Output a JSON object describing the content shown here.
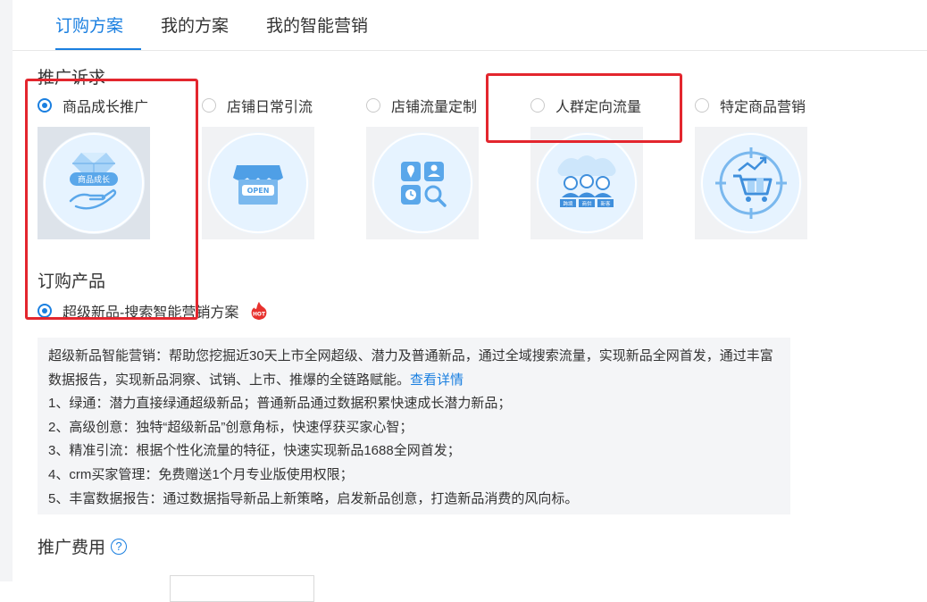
{
  "tabs": [
    {
      "label": "订购方案",
      "active": true
    },
    {
      "label": "我的方案",
      "active": false
    },
    {
      "label": "我的智能营销",
      "active": false
    }
  ],
  "promotion": {
    "title": "推广诉求",
    "options": [
      {
        "label": "商品成长推广",
        "checked": true,
        "icon": "diamond-growth-icon",
        "badge_text": "商品成长"
      },
      {
        "label": "店铺日常引流",
        "checked": false,
        "icon": "open-store-icon",
        "badge_text": "OPEN"
      },
      {
        "label": "店铺流量定制",
        "checked": false,
        "icon": "location-user-clock-search-icon"
      },
      {
        "label": "人群定向流量",
        "checked": false,
        "icon": "crowd-people-icon",
        "tags": [
          "跨境",
          "商供",
          "新客"
        ]
      },
      {
        "label": "特定商品营销",
        "checked": false,
        "icon": "target-cart-icon"
      }
    ]
  },
  "product": {
    "title": "订购产品",
    "option_label": "超级新品-搜索智能营销方案",
    "checked": true,
    "hot_badge": "HOT"
  },
  "description": {
    "intro": "超级新品智能营销：帮助您挖掘近30天上市全网超级、潜力及普通新品，通过全域搜索流量，实现新品全网首发，通过丰富数据报告，实现新品洞察、试销、上市、推爆的全链路赋能。",
    "link": "查看详情",
    "items": [
      "1、绿通：潜力直接绿通超级新品；普通新品通过数据积累快速成长潜力新品；",
      "2、高级创意：独特“超级新品”创意角标，快速俘获买家心智；",
      "3、精准引流：根据个性化流量的特征，快速实现新品1688全网首发；",
      "4、crm买家管理：免费赠送1个月专业版使用权限；",
      "5、丰富数据报告：通过数据指导新品上新策略，启发新品创意，打造新品消费的风向标。"
    ]
  },
  "fee": {
    "title": "推广费用",
    "help_icon": "?"
  },
  "colors": {
    "accent": "#1a7fe0",
    "annotation": "#e3262e",
    "icon_light": "#cde6fb",
    "icon_mid": "#7ab8ee"
  }
}
